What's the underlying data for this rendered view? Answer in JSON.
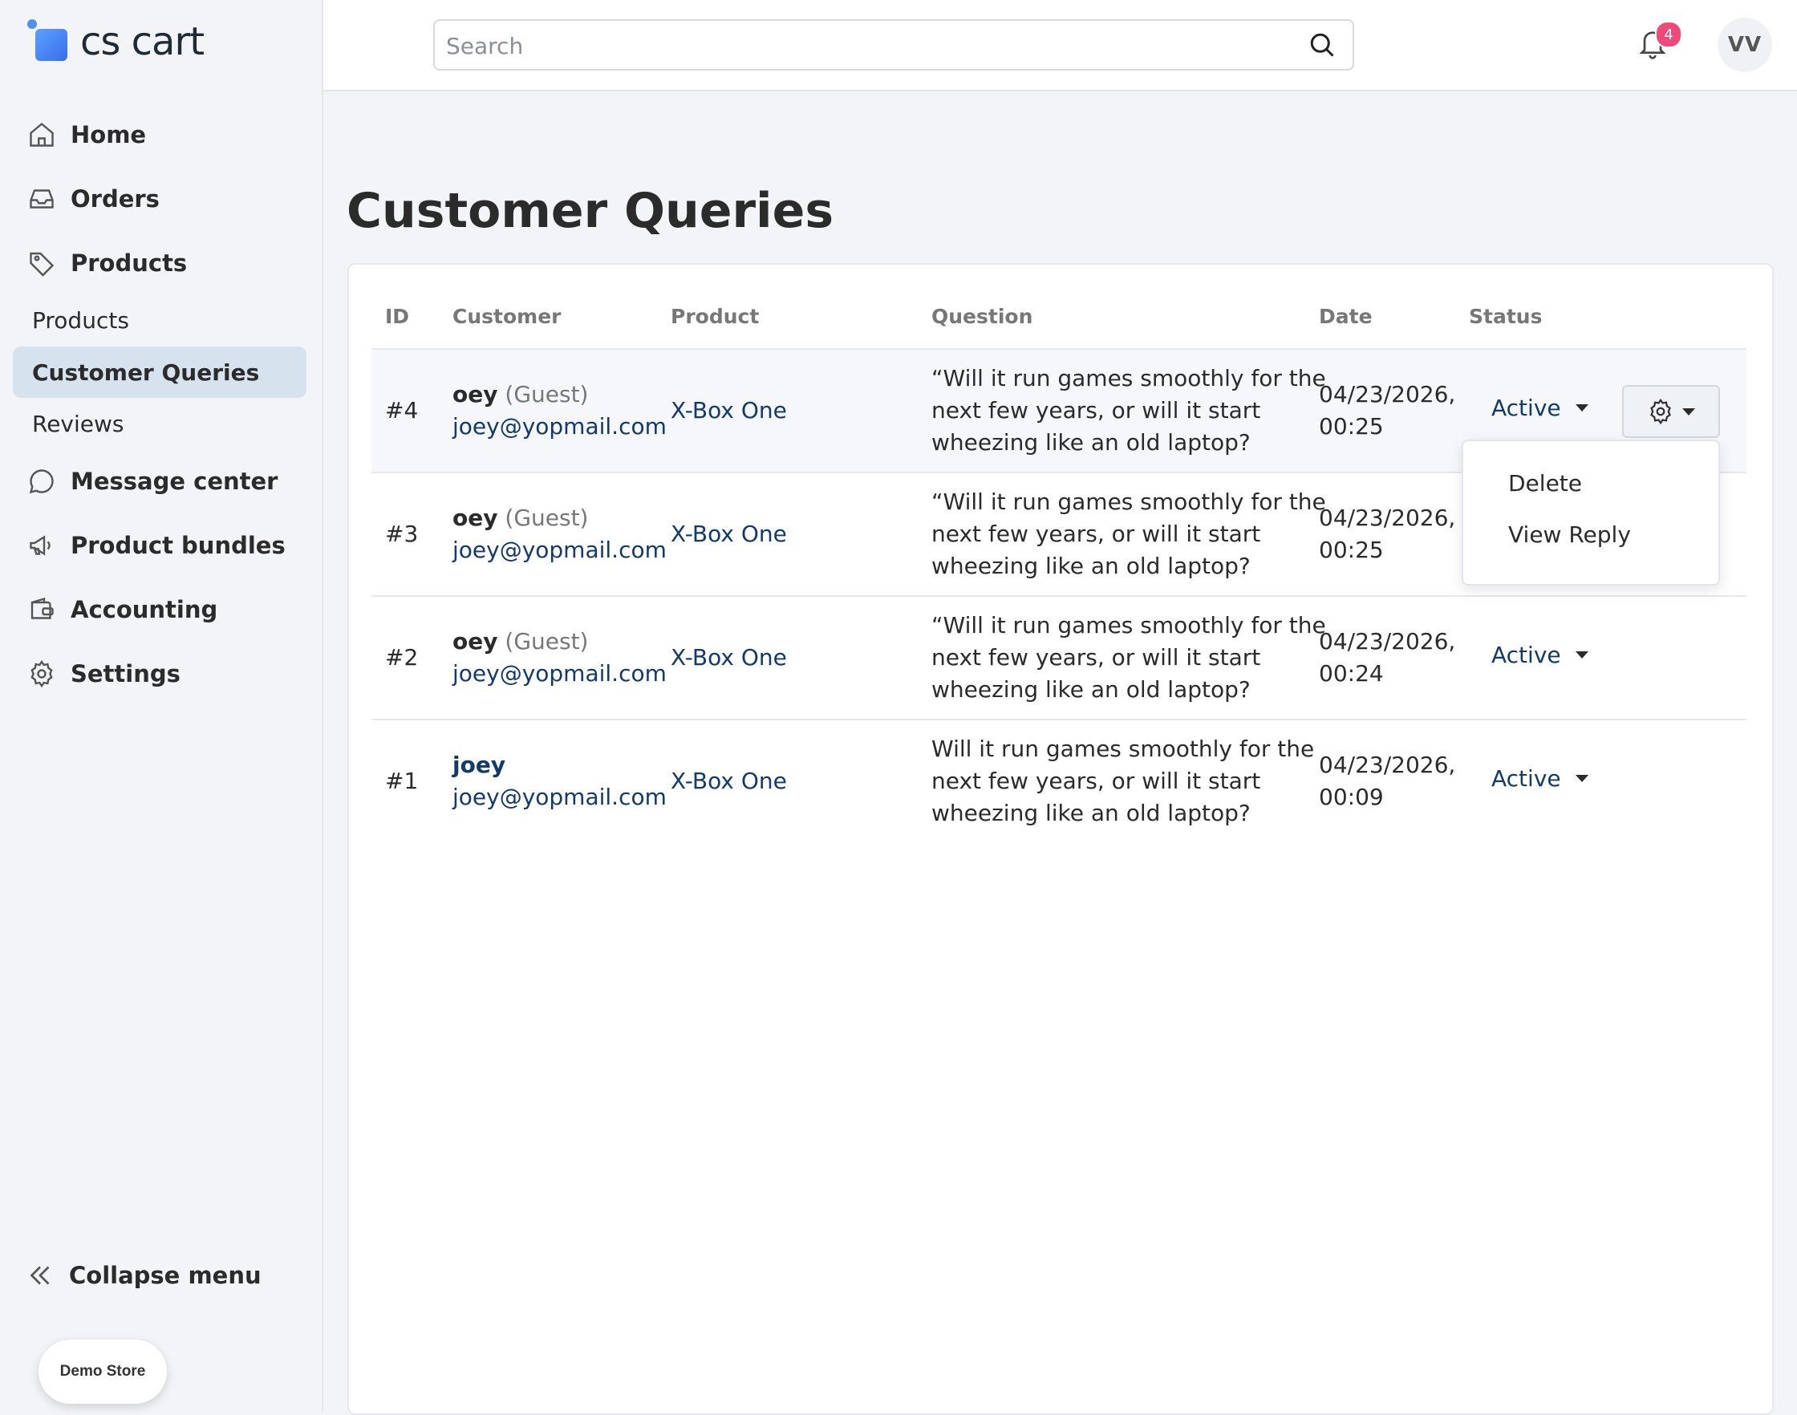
{
  "brand": {
    "logo_text": "cs cart"
  },
  "sidebar": {
    "items": [
      {
        "label": "Home",
        "icon": "home-icon"
      },
      {
        "label": "Orders",
        "icon": "inbox-icon"
      },
      {
        "label": "Products",
        "icon": "tag-icon"
      }
    ],
    "sub_items": [
      {
        "label": "Products",
        "active": false
      },
      {
        "label": "Customer Queries",
        "active": true
      },
      {
        "label": "Reviews",
        "active": false
      }
    ],
    "items2": [
      {
        "label": "Message center",
        "icon": "chat-icon"
      },
      {
        "label": "Product bundles",
        "icon": "megaphone-icon"
      },
      {
        "label": "Accounting",
        "icon": "wallet-icon"
      },
      {
        "label": "Settings",
        "icon": "gear-icon"
      }
    ],
    "collapse_label": "Collapse menu",
    "store_label": "Demo Store"
  },
  "header": {
    "search_placeholder": "Search",
    "notification_count": "4",
    "avatar_initials": "VV"
  },
  "page": {
    "title": "Customer Queries"
  },
  "table": {
    "columns": [
      "ID",
      "Customer",
      "Product",
      "Question",
      "Date",
      "Status"
    ],
    "rows": [
      {
        "id": "#4",
        "name": "oey",
        "guest": "(Guest)",
        "email": "joey@yopmail.com",
        "product": "X-Box One",
        "question_lines": [
          "“Will it run games smoothly for the",
          "next few years, or will it start",
          "wheezing like an old laptop?"
        ],
        "date_lines": [
          "04/23/2026,",
          "00:25"
        ],
        "status": "Active"
      },
      {
        "id": "#3",
        "name": "oey",
        "guest": "(Guest)",
        "email": "joey@yopmail.com",
        "product": "X-Box One",
        "question_lines": [
          "“Will it run games smoothly for the",
          "next few years, or will it start",
          "wheezing like an old laptop?"
        ],
        "date_lines": [
          "04/23/2026,",
          "00:25"
        ],
        "status": ""
      },
      {
        "id": "#2",
        "name": "oey",
        "guest": "(Guest)",
        "email": "joey@yopmail.com",
        "product": "X-Box One",
        "question_lines": [
          "“Will it run games smoothly for the",
          "next few years, or will it start",
          "wheezing like an old laptop?"
        ],
        "date_lines": [
          "04/23/2026,",
          "00:24"
        ],
        "status": "Active"
      },
      {
        "id": "#1",
        "name": "joey",
        "guest": "",
        "email": "joey@yopmail.com",
        "product": "X-Box One",
        "question_lines": [
          "Will it run games smoothly for the",
          "next few years, or will it start",
          "wheezing like an old laptop?"
        ],
        "date_lines": [
          "04/23/2026,",
          "00:09"
        ],
        "status": "Active"
      }
    ]
  },
  "dropdown": {
    "items": [
      "Delete",
      "View Reply"
    ]
  },
  "colors": {
    "accent": "#123a6b",
    "active_nav_bg": "#d7e2ef",
    "badge": "#ef4a7a"
  }
}
